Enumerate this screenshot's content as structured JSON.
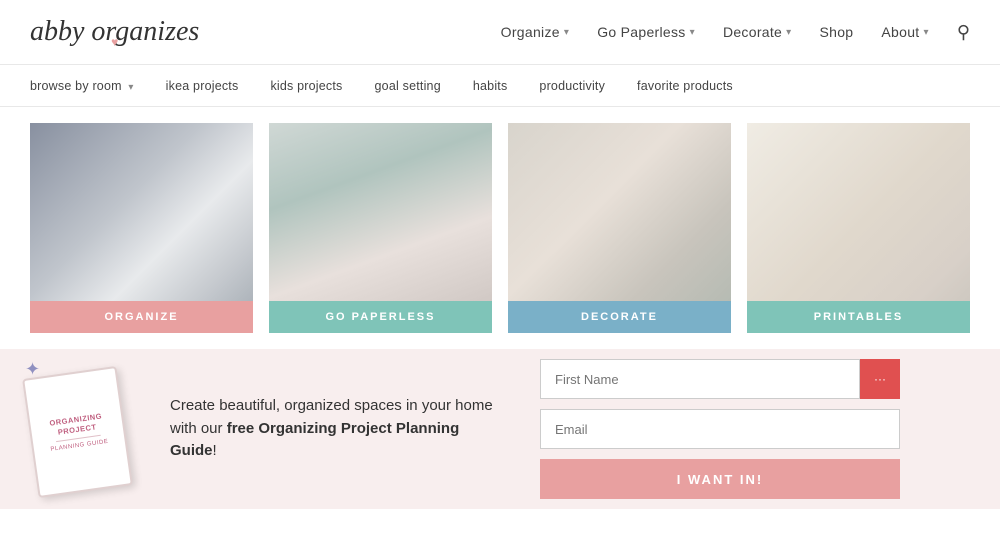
{
  "logo": {
    "text": "abby organizes",
    "heart": "♥"
  },
  "nav": {
    "items": [
      {
        "label": "Organize",
        "has_dropdown": true
      },
      {
        "label": "Go Paperless",
        "has_dropdown": true
      },
      {
        "label": "Decorate",
        "has_dropdown": true
      },
      {
        "label": "Shop",
        "has_dropdown": false
      },
      {
        "label": "About",
        "has_dropdown": true
      }
    ]
  },
  "subnav": {
    "items": [
      {
        "label": "browse by room",
        "has_dropdown": true
      },
      {
        "label": "ikea projects"
      },
      {
        "label": "kids projects"
      },
      {
        "label": "goal setting"
      },
      {
        "label": "habits"
      },
      {
        "label": "productivity"
      },
      {
        "label": "favorite products"
      }
    ]
  },
  "cards": [
    {
      "label": "ORGANIZE",
      "color_class": "label-pink img-organize"
    },
    {
      "label": "GO PAPERLESS",
      "color_class": "label-teal img-paperless"
    },
    {
      "label": "DECORATE",
      "color_class": "label-blue img-decorate"
    },
    {
      "label": "PRINTABLES",
      "color_class": "label-teal img-printables"
    }
  ],
  "cta": {
    "text_before": "Create beautiful, organized spaces in your home with our ",
    "text_bold": "free Organizing Project Planning Guide",
    "text_after": "!"
  },
  "book": {
    "line1": "ORGANIZING PROJECT",
    "line2": "planning guide"
  },
  "form": {
    "first_name_placeholder": "First Name",
    "email_placeholder": "Email",
    "submit_label": "I WANT IN!"
  }
}
